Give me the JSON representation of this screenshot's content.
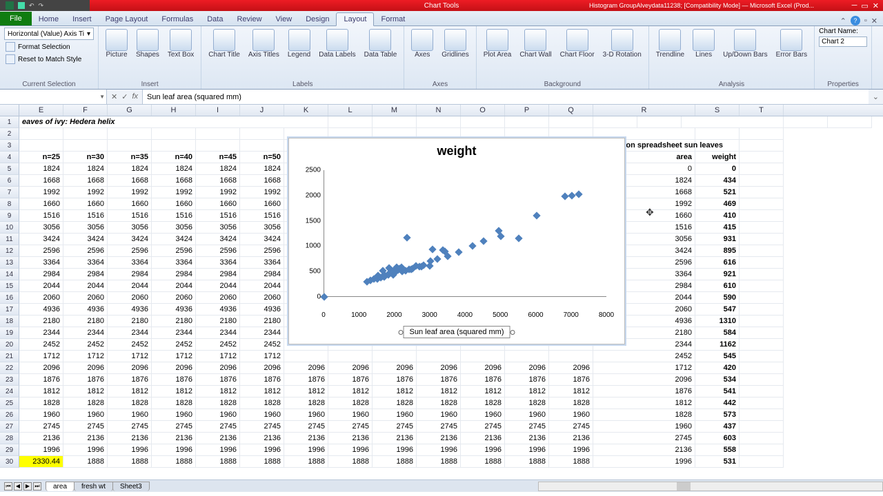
{
  "window": {
    "context_title": "Chart Tools",
    "document_title": "Histogram GroupAlveydata11238; [Compatibility Mode] — Microsoft Excel (Prod...",
    "qat": [
      "save",
      "undo",
      "redo"
    ]
  },
  "tabs": [
    "File",
    "Home",
    "Insert",
    "Page Layout",
    "Formulas",
    "Data",
    "Review",
    "View",
    "Design",
    "Layout",
    "Format"
  ],
  "active_tab": "Layout",
  "ribbon": {
    "selection": {
      "current": "Horizontal (Value) Axis Ti",
      "format_selection": "Format Selection",
      "reset": "Reset to Match Style",
      "group": "Current Selection"
    },
    "insert": {
      "items": [
        "Picture",
        "Shapes",
        "Text Box"
      ],
      "group": "Insert"
    },
    "labels": {
      "items": [
        "Chart Title",
        "Axis Titles",
        "Legend",
        "Data Labels",
        "Data Table"
      ],
      "group": "Labels"
    },
    "axes": {
      "items": [
        "Axes",
        "Gridlines"
      ],
      "group": "Axes"
    },
    "background": {
      "items": [
        "Plot Area",
        "Chart Wall",
        "Chart Floor",
        "3-D Rotation"
      ],
      "group": "Background"
    },
    "analysis": {
      "items": [
        "Trendline",
        "Lines",
        "Up/Down Bars",
        "Error Bars"
      ],
      "group": "Analysis"
    },
    "properties": {
      "label": "Chart Name:",
      "value": "Chart 2",
      "group": "Properties"
    }
  },
  "formula_bar": {
    "name_box": "",
    "formula": "Sun leaf area (squared mm)"
  },
  "columns": [
    "E",
    "F",
    "G",
    "H",
    "I",
    "J",
    "K",
    "L",
    "M",
    "N",
    "O",
    "P",
    "Q",
    "R",
    "S",
    "T"
  ],
  "title_cell": "eaves of ivy: Hedera helix",
  "header_row": [
    "n=25",
    "n=30",
    "n=35",
    "n=40",
    "n=45",
    "n=50"
  ],
  "data_values": [
    1824,
    1668,
    1992,
    1660,
    1516,
    3056,
    3424,
    2596,
    3364,
    2984,
    2044,
    2060,
    4936,
    2180,
    2344,
    2452,
    1712,
    2096,
    1876,
    1812,
    1828,
    1960,
    2745,
    2136,
    1996
  ],
  "row30_E": "2330.44",
  "row30_rest": 1888,
  "correlation": {
    "title": "correlation spreadsheet sun leaves",
    "h1": "area",
    "h2": "weight",
    "rows": [
      [
        0,
        0
      ],
      [
        1824,
        434
      ],
      [
        1668,
        521
      ],
      [
        1992,
        469
      ],
      [
        1660,
        410
      ],
      [
        1516,
        415
      ],
      [
        3056,
        931
      ],
      [
        3424,
        895
      ],
      [
        2596,
        616
      ],
      [
        3364,
        921
      ],
      [
        2984,
        610
      ],
      [
        2044,
        590
      ],
      [
        2060,
        547
      ],
      [
        4936,
        1310
      ],
      [
        2180,
        584
      ],
      [
        2344,
        1162
      ],
      [
        2452,
        545
      ],
      [
        1712,
        420
      ],
      [
        2096,
        534
      ],
      [
        1876,
        541
      ],
      [
        1812,
        442
      ],
      [
        1828,
        573
      ],
      [
        1960,
        437
      ],
      [
        2745,
        603
      ],
      [
        2136,
        558
      ],
      [
        1996,
        531
      ]
    ]
  },
  "chart_data": {
    "type": "scatter",
    "title": "weight",
    "xlabel": "Sun leaf area (squared mm)",
    "ylabel": "",
    "xlim": [
      0,
      8000
    ],
    "ylim": [
      0,
      2500
    ],
    "xticks": [
      0,
      1000,
      2000,
      3000,
      4000,
      5000,
      6000,
      7000,
      8000
    ],
    "yticks": [
      0,
      500,
      1000,
      1500,
      2000,
      2500
    ],
    "series": [
      {
        "name": "weight",
        "x_source": "area",
        "y_source": "weight",
        "points": [
          [
            0,
            0
          ],
          [
            1824,
            434
          ],
          [
            1668,
            521
          ],
          [
            1992,
            469
          ],
          [
            1660,
            410
          ],
          [
            1516,
            415
          ],
          [
            3056,
            931
          ],
          [
            3424,
            895
          ],
          [
            2596,
            616
          ],
          [
            3364,
            921
          ],
          [
            2984,
            610
          ],
          [
            2044,
            590
          ],
          [
            2060,
            547
          ],
          [
            4936,
            1310
          ],
          [
            2180,
            584
          ],
          [
            2344,
            1162
          ],
          [
            2452,
            545
          ],
          [
            1712,
            420
          ],
          [
            2096,
            534
          ],
          [
            1876,
            541
          ],
          [
            1812,
            442
          ],
          [
            1828,
            573
          ],
          [
            1960,
            437
          ],
          [
            2745,
            603
          ],
          [
            2136,
            558
          ],
          [
            1996,
            531
          ],
          [
            1200,
            300
          ],
          [
            1300,
            320
          ],
          [
            1400,
            350
          ],
          [
            1500,
            360
          ],
          [
            1600,
            380
          ],
          [
            1700,
            390
          ],
          [
            2200,
            500
          ],
          [
            2300,
            520
          ],
          [
            2400,
            540
          ],
          [
            2500,
            560
          ],
          [
            2700,
            600
          ],
          [
            2800,
            620
          ],
          [
            3000,
            700
          ],
          [
            3200,
            750
          ],
          [
            3500,
            800
          ],
          [
            3800,
            880
          ],
          [
            4200,
            1000
          ],
          [
            4500,
            1100
          ],
          [
            5000,
            1200
          ],
          [
            5500,
            1150
          ],
          [
            6000,
            1600
          ],
          [
            6800,
            1980
          ],
          [
            7000,
            2000
          ],
          [
            7200,
            2020
          ]
        ]
      }
    ]
  },
  "sheet_tabs": [
    "area",
    "fresh wt",
    "Sheet3"
  ],
  "active_sheet": "area"
}
